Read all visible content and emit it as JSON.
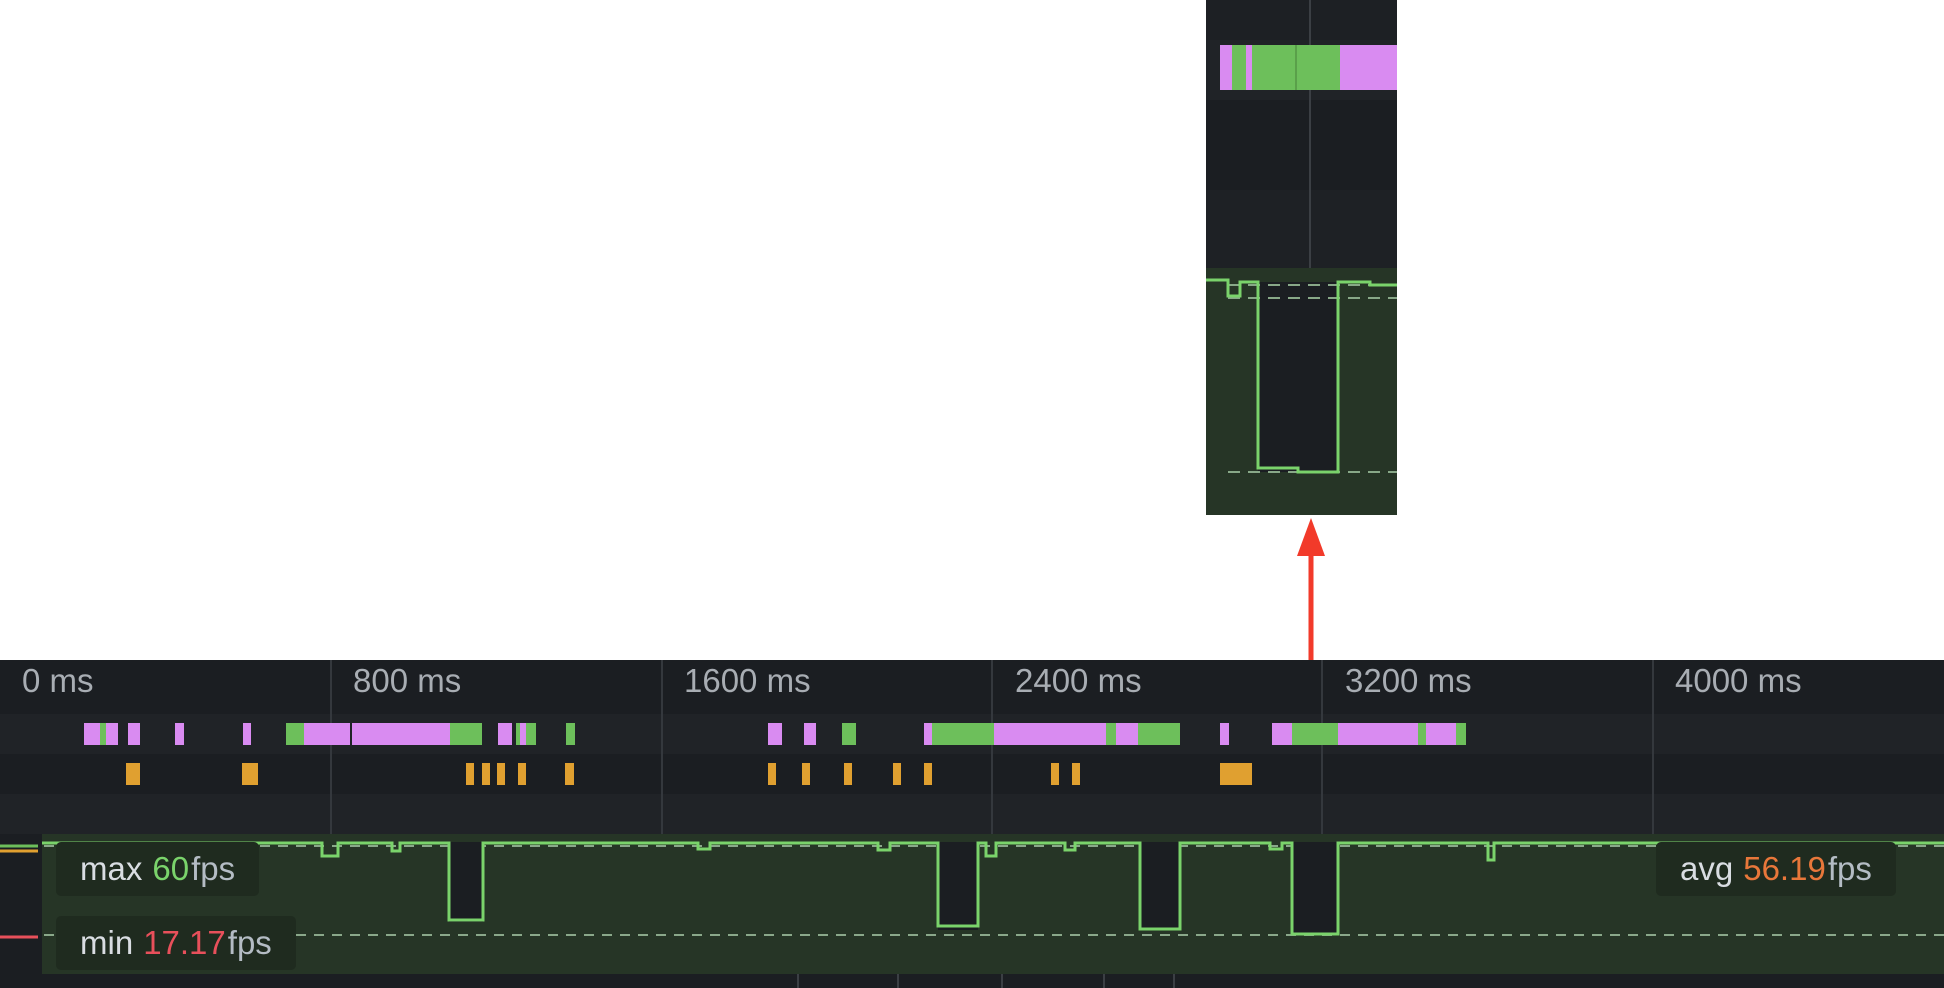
{
  "timeline": {
    "ticks": [
      "0 ms",
      "800 ms",
      "1600 ms",
      "2400 ms",
      "3200 ms",
      "4000 ms"
    ],
    "fps": {
      "max_label": "max",
      "max_value": "60",
      "min_label": "min",
      "min_value": "17.17",
      "avg_label": "avg",
      "avg_value": "56.19",
      "unit": "fps"
    }
  },
  "colors": {
    "painting": "#d98bf1",
    "rendering": "#6dbf5b",
    "scripting": "#e0a030",
    "fps_line": "#7ad36b",
    "annotation_arrow": "#f23a2a"
  }
}
